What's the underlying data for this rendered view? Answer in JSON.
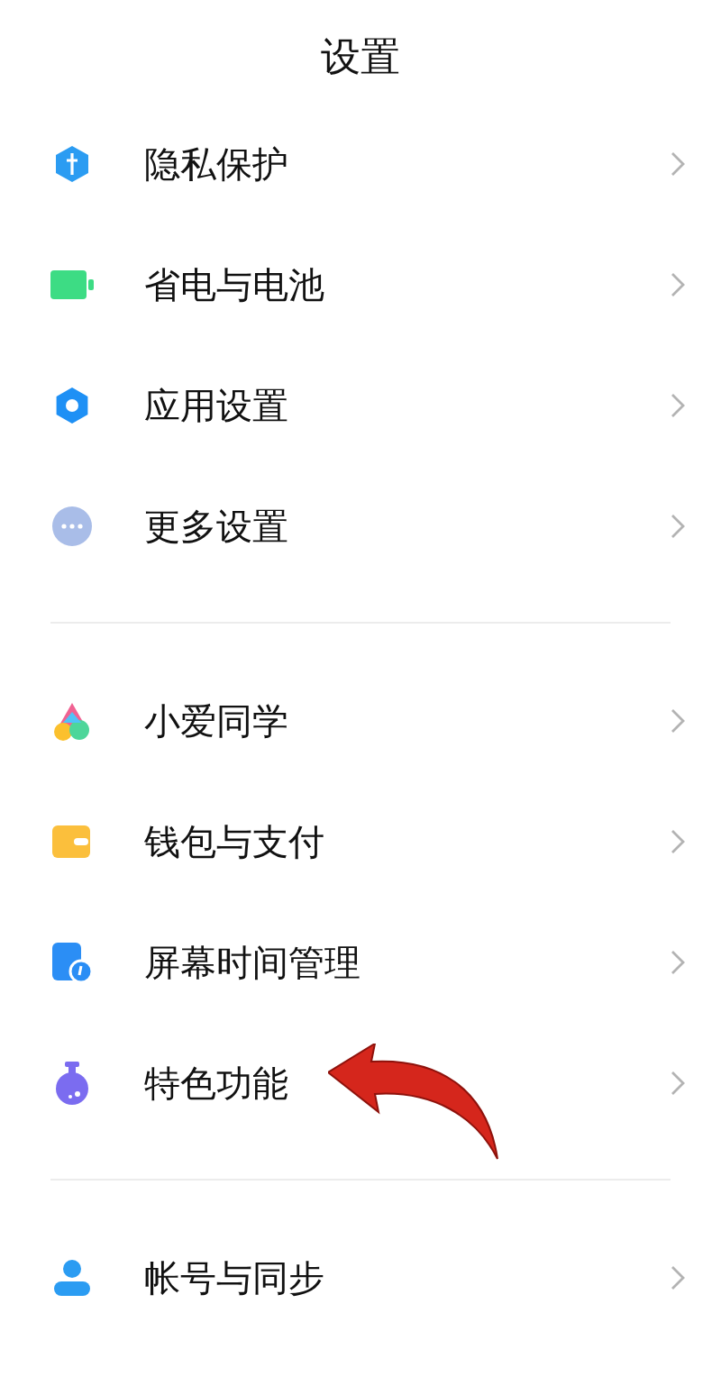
{
  "title": "设置",
  "groups": [
    {
      "items": [
        {
          "label": "隐私保护"
        },
        {
          "label": "省电与电池"
        },
        {
          "label": "应用设置"
        },
        {
          "label": "更多设置"
        }
      ]
    },
    {
      "items": [
        {
          "label": "小爱同学"
        },
        {
          "label": "钱包与支付"
        },
        {
          "label": "屏幕时间管理"
        },
        {
          "label": "特色功能",
          "pointed": true
        }
      ]
    },
    {
      "items": [
        {
          "label": "帐号与同步"
        }
      ]
    }
  ]
}
